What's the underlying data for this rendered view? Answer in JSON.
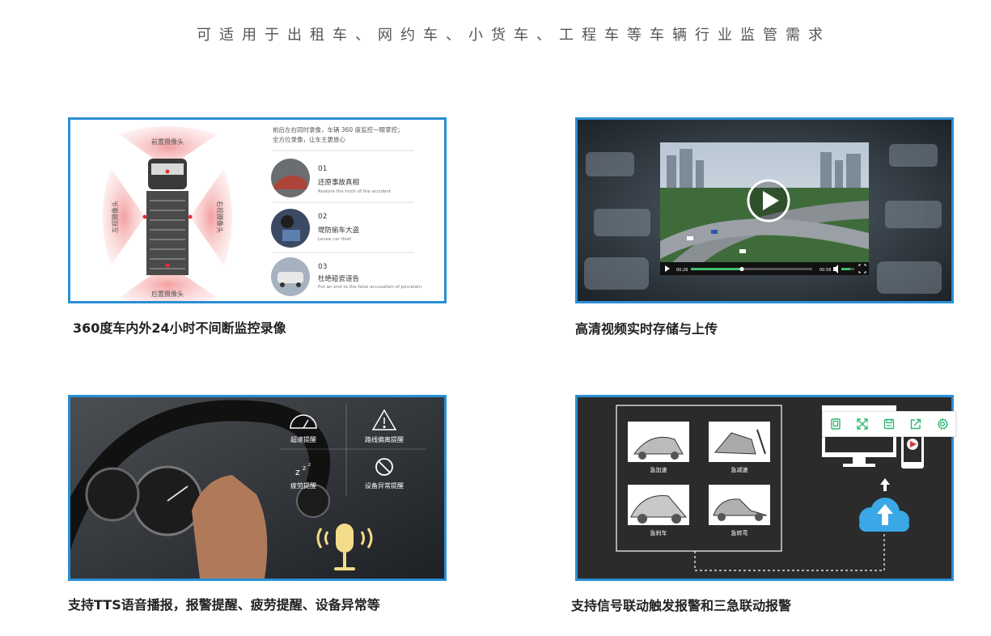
{
  "page": {
    "subtitle": "可适用于出租车、网约车、小货车、工程车等车辆行业监管需求"
  },
  "features": [
    {
      "caption": "360度车内外24小时不间断监控录像",
      "panel": {
        "intro_line1": "前后左右同时录像，车辆 360 度监控一眼掌控；",
        "intro_line2": "全方位录像，让车主更放心",
        "camera_front": "前置摄像头",
        "camera_rear": "后置摄像头",
        "camera_left": "左视摄像头",
        "camera_right": "右视摄像头",
        "items": [
          {
            "num": "01",
            "title": "还原事故真相",
            "subtitle": "Restore the truth of the accident"
          },
          {
            "num": "02",
            "title": "堤防偷车大盗",
            "subtitle": "Levee car thief"
          },
          {
            "num": "03",
            "title": "杜绝碰瓷诬告",
            "subtitle": "Put an end to the false accusation of porcelain"
          }
        ]
      }
    },
    {
      "caption": "高清视频实时存储与上传",
      "panel": {
        "time_current": "00:26",
        "time_total": "00:56",
        "progress": 0.42,
        "volume": 0.7
      }
    },
    {
      "caption": "支持TTS语音播报，报警提醒、疲劳提醒、设备异常等",
      "panel": {
        "alerts": [
          {
            "label": "超速提醒",
            "icon": "speedometer-icon"
          },
          {
            "label": "路线偏离提醒",
            "icon": "warning-triangle-icon"
          },
          {
            "label": "疲劳提醒",
            "icon": "zzz-icon"
          },
          {
            "label": "设备异常提醒",
            "icon": "prohibited-icon"
          }
        ]
      }
    },
    {
      "caption": "支持信号联动触发报警和三急联动报警",
      "panel": {
        "events": [
          "急加速",
          "急减速",
          "急刹车",
          "急转弯"
        ]
      }
    }
  ],
  "toolbar": {
    "buttons": [
      "copy-icon",
      "fullscreen-icon",
      "save-icon",
      "share-icon",
      "settings-icon"
    ],
    "accent": "#2bb673"
  },
  "colors": {
    "frame": "#2a8fd4",
    "dark_panel": "#2b2b2b",
    "cloud": "#3aa7e6",
    "mic": "#f3dc8a"
  }
}
